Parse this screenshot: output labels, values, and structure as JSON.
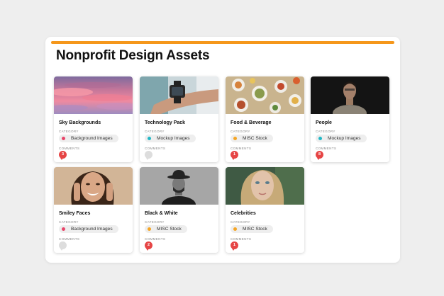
{
  "colors": {
    "accent": "#f5971b",
    "dot_pink": "#e8466a",
    "dot_teal": "#22b8c6",
    "dot_orange": "#f5a524",
    "badge_red": "#e64545"
  },
  "board": {
    "title": "Nonprofit Design Assets"
  },
  "labels": {
    "category": "CATEGORY",
    "comments": "COMMENTS"
  },
  "cards": [
    {
      "title": "Sky Backgrounds",
      "category": "Background Images",
      "comments": "3",
      "image": "pink sunset clouds"
    },
    {
      "title": "Technology Pack",
      "category": "Mockup Images",
      "comments": "",
      "image": "smartwatch on wrist"
    },
    {
      "title": "Food & Beverage",
      "category": "MISC Stock",
      "comments": "1",
      "image": "food table top view"
    },
    {
      "title": "People",
      "category": "Mockup Images",
      "comments": "8",
      "image": "man portrait dark"
    },
    {
      "title": "Smiley Faces",
      "category": "Background Images",
      "comments": "",
      "image": "smiling woman"
    },
    {
      "title": "Black & White",
      "category": "MISC Stock",
      "comments": "2",
      "image": "man with hat bw"
    },
    {
      "title": "Celebrities",
      "category": "MISC Stock",
      "comments": "1",
      "image": "blonde woman portrait"
    }
  ]
}
